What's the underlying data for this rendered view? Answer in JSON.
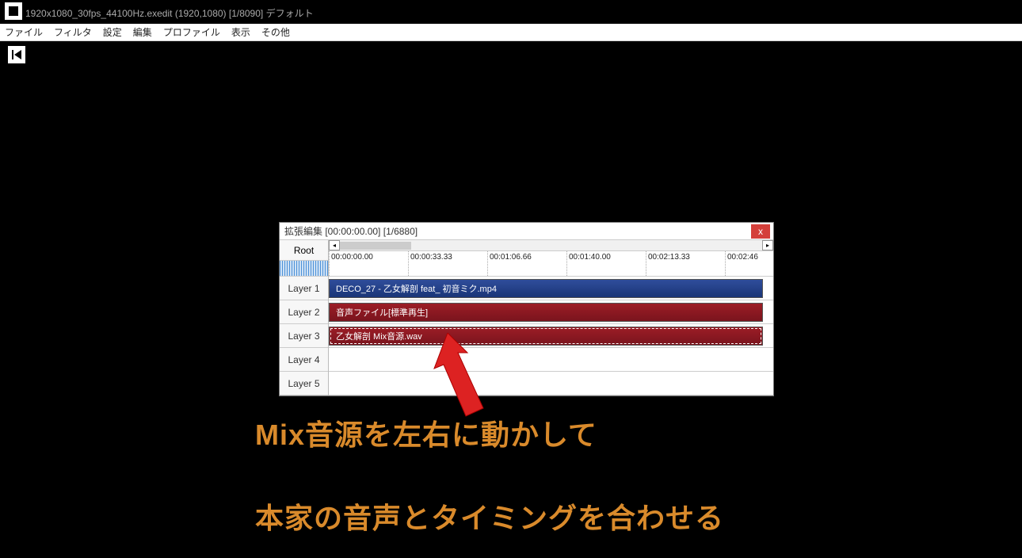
{
  "title_text": "1920x1080_30fps_44100Hz.exedit (1920,1080)  [1/8090]  デフォルト",
  "menu": [
    "ファイル",
    "フィルタ",
    "設定",
    "編集",
    "プロファイル",
    "表示",
    "その他"
  ],
  "timeline": {
    "title": "拡張編集 [00:00:00.00] [1/6880]",
    "close_label": "x",
    "root_label": "Root",
    "layers": [
      "Layer 1",
      "Layer 2",
      "Layer 3",
      "Layer 4",
      "Layer 5"
    ],
    "ticks": [
      {
        "pos": 0,
        "label": "00:00:00.00"
      },
      {
        "pos": 100,
        "label": "00:00:33.33"
      },
      {
        "pos": 200,
        "label": "00:01:06.66"
      },
      {
        "pos": 300,
        "label": "00:01:40.00"
      },
      {
        "pos": 400,
        "label": "00:02:13.33"
      },
      {
        "pos": 500,
        "label": "00:02:46"
      }
    ],
    "clips": {
      "layer1": "DECO_27 - 乙女解剖 feat_ 初音ミク.mp4",
      "layer2": "音声ファイル[標準再生]",
      "layer3": "乙女解剖 Mix音源.wav"
    }
  },
  "caption_line1": "Mix音源を左右に動かして",
  "caption_line2": "本家の音声とタイミングを合わせる"
}
